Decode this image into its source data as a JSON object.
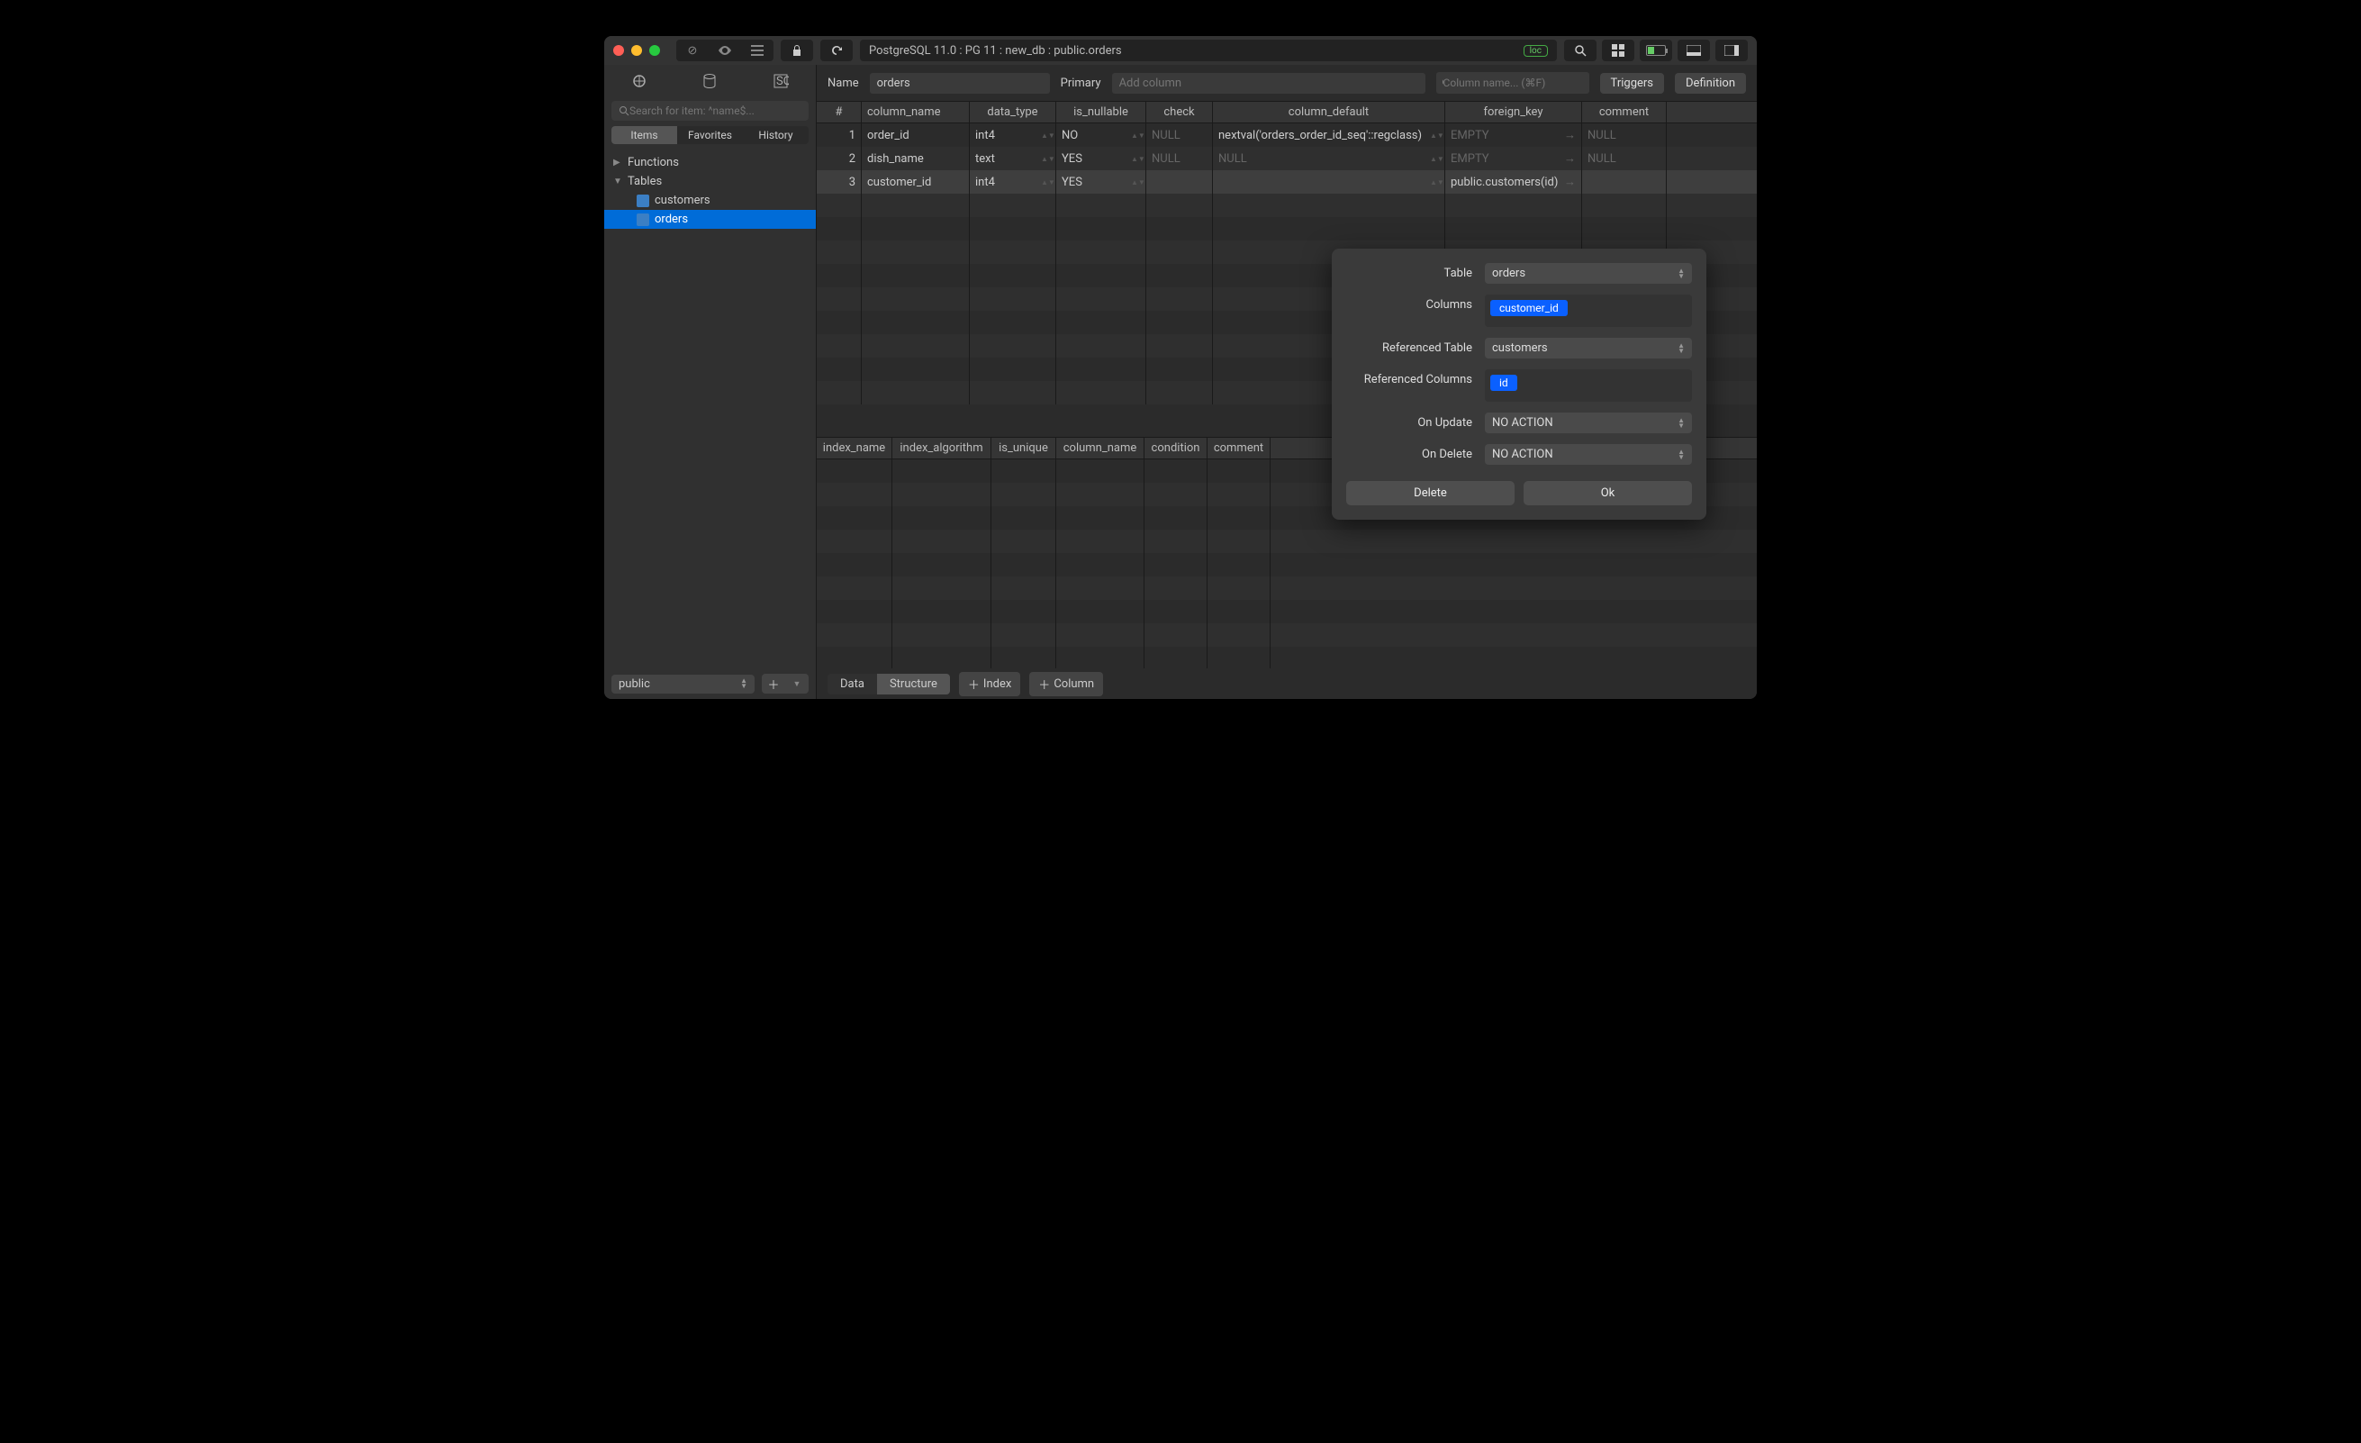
{
  "titlebar": {
    "breadcrumb": "PostgreSQL 11.0 : PG 11 : new_db : public.orders",
    "loc_badge": "loc"
  },
  "sidebar": {
    "search_placeholder": "Search for item: ^name$...",
    "tabs": {
      "items": "Items",
      "favorites": "Favorites",
      "history": "History"
    },
    "tree": {
      "functions": "Functions",
      "tables": "Tables",
      "tables_children": [
        "customers",
        "orders"
      ]
    },
    "schema": "public"
  },
  "topbar": {
    "name_label": "Name",
    "name_value": "orders",
    "primary_label": "Primary",
    "primary_placeholder": "Add column",
    "col_search_placeholder": "Column name... (⌘F)",
    "triggers_btn": "Triggers",
    "definition_btn": "Definition"
  },
  "columns_grid": {
    "headers": {
      "num": "#",
      "name": "column_name",
      "type": "data_type",
      "nullable": "is_nullable",
      "check": "check",
      "default": "column_default",
      "fk": "foreign_key",
      "comment": "comment"
    },
    "rows": [
      {
        "n": "1",
        "name": "order_id",
        "type": "int4",
        "nullable": "NO",
        "check": "NULL",
        "default": "nextval('orders_order_id_seq'::regclass)",
        "fk": "EMPTY",
        "comment": "NULL"
      },
      {
        "n": "2",
        "name": "dish_name",
        "type": "text",
        "nullable": "YES",
        "check": "NULL",
        "default": "NULL",
        "fk": "EMPTY",
        "comment": "NULL"
      },
      {
        "n": "3",
        "name": "customer_id",
        "type": "int4",
        "nullable": "YES",
        "check": "",
        "default": "",
        "fk": "public.customers(id)",
        "comment": ""
      }
    ]
  },
  "index_grid": {
    "headers": {
      "name": "index_name",
      "algo": "index_algorithm",
      "unique": "is_unique",
      "col": "column_name",
      "cond": "condition",
      "comment": "comment"
    }
  },
  "footer": {
    "data": "Data",
    "structure": "Structure",
    "index": "Index",
    "column": "Column"
  },
  "popover": {
    "labels": {
      "table": "Table",
      "columns": "Columns",
      "ref_table": "Referenced Table",
      "ref_cols": "Referenced Columns",
      "on_update": "On Update",
      "on_delete": "On Delete"
    },
    "values": {
      "table": "orders",
      "columns_tag": "customer_id",
      "ref_table": "customers",
      "ref_cols_tag": "id",
      "on_update": "NO ACTION",
      "on_delete": "NO ACTION"
    },
    "buttons": {
      "delete": "Delete",
      "ok": "Ok"
    }
  }
}
